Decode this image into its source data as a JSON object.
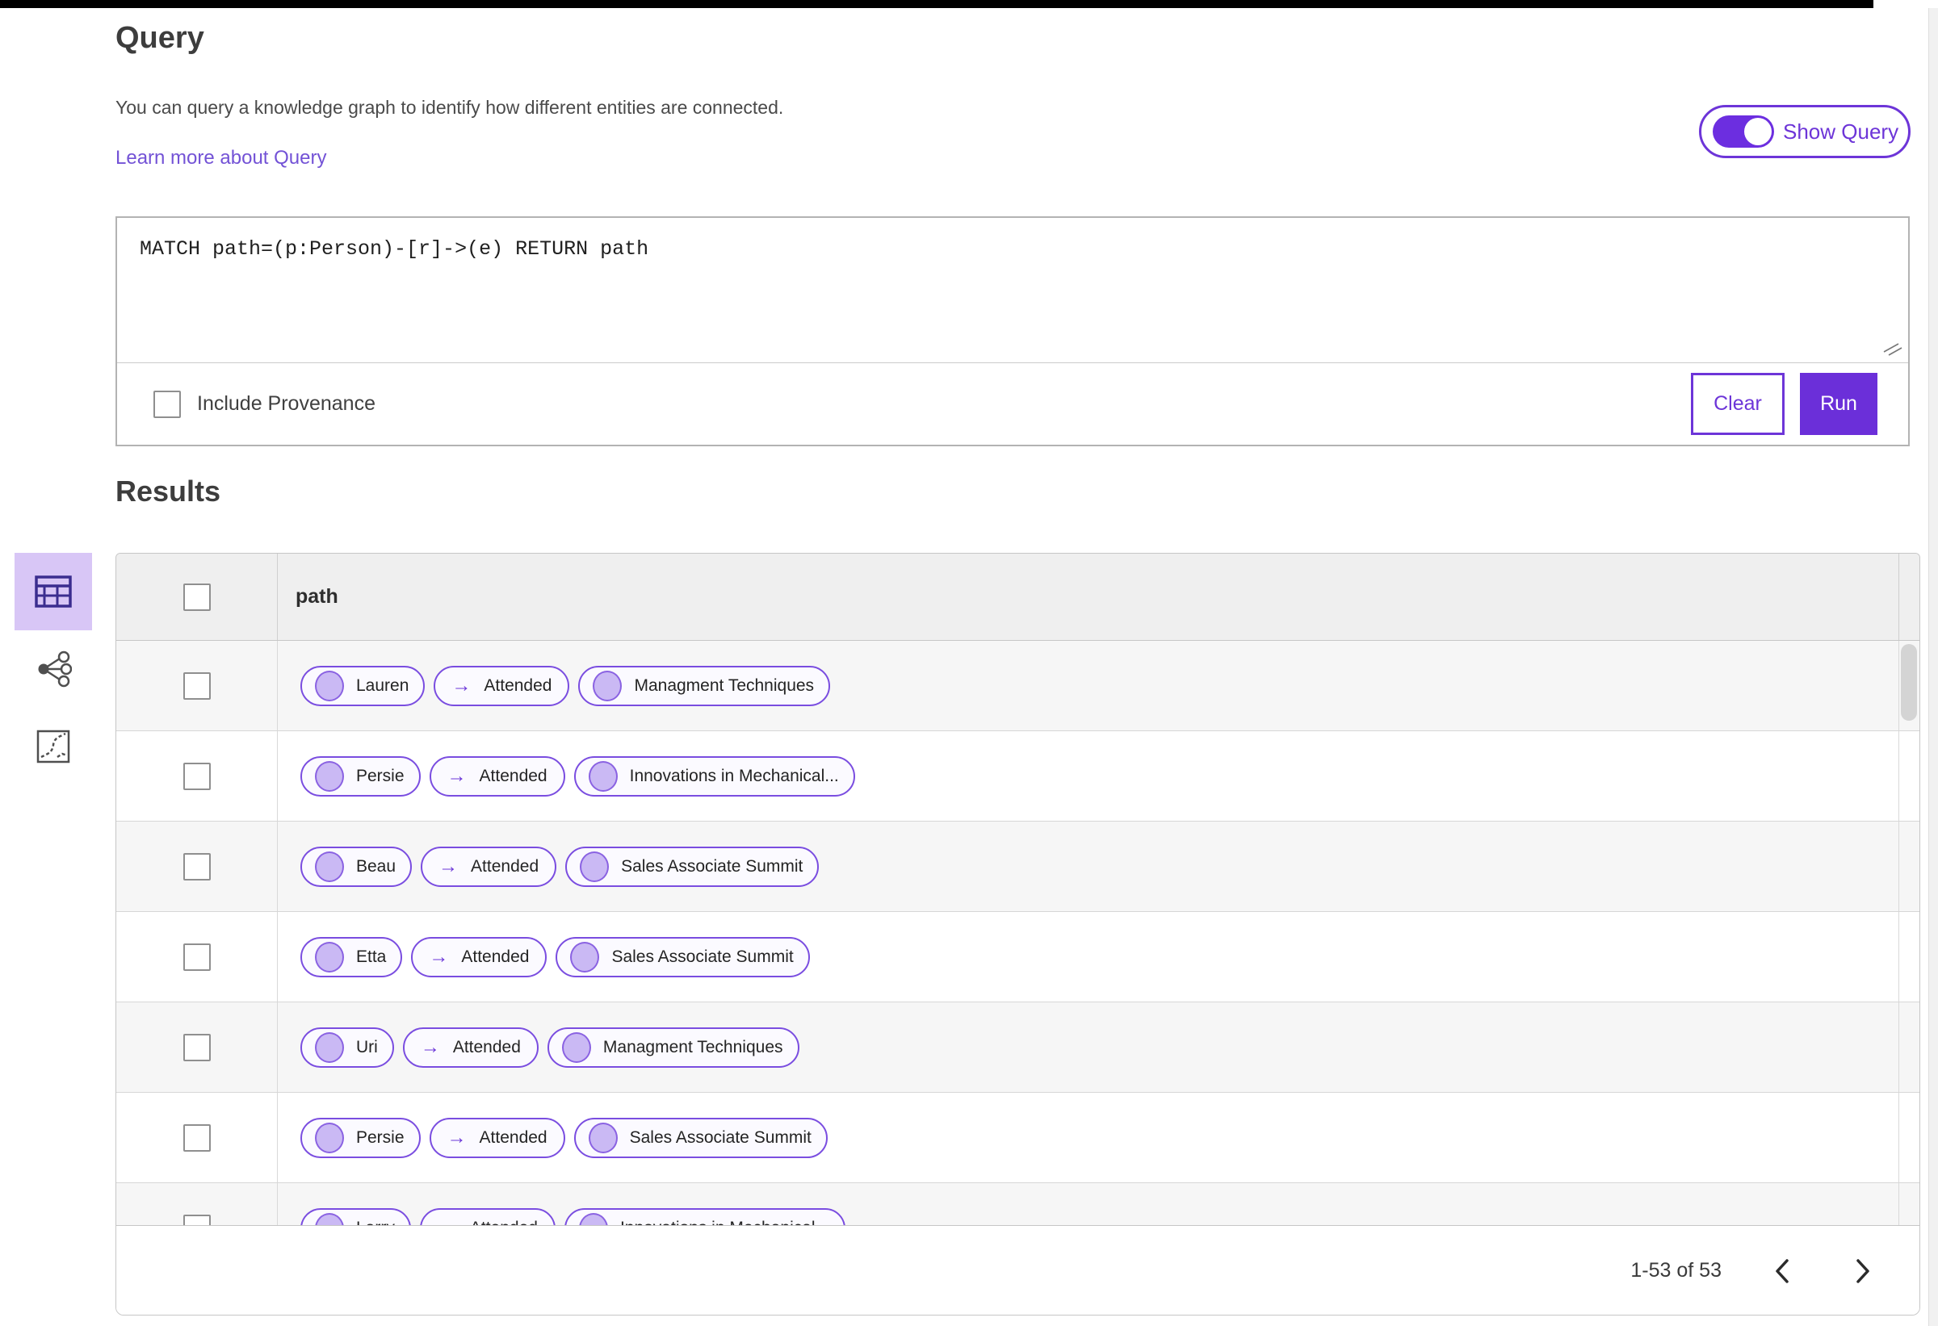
{
  "header": {
    "title": "Query",
    "description": "You can query a knowledge graph to identify how different entities are connected.",
    "learn_more": "Learn more about Query",
    "show_query": {
      "label": "Show Query",
      "state": "on"
    }
  },
  "query_panel": {
    "query_text": "MATCH path=(p:Person)-[r]->(e) RETURN path",
    "include_provenance": {
      "label": "Include Provenance",
      "checked": false
    },
    "clear_label": "Clear",
    "run_label": "Run"
  },
  "results": {
    "title": "Results",
    "column_header": "path",
    "views": [
      {
        "name": "table-view",
        "icon": "table-icon",
        "selected": true
      },
      {
        "name": "graph-view",
        "icon": "network-icon",
        "selected": false
      },
      {
        "name": "chart-view",
        "icon": "chart-icon",
        "selected": false
      }
    ],
    "arrow_glyph": "→",
    "rows": [
      {
        "source": "Lauren",
        "edge": "Attended",
        "target": "Managment Techniques"
      },
      {
        "source": "Persie",
        "edge": "Attended",
        "target": "Innovations in Mechanical..."
      },
      {
        "source": "Beau",
        "edge": "Attended",
        "target": "Sales Associate Summit"
      },
      {
        "source": "Etta",
        "edge": "Attended",
        "target": "Sales Associate Summit"
      },
      {
        "source": "Uri",
        "edge": "Attended",
        "target": "Managment Techniques"
      },
      {
        "source": "Persie",
        "edge": "Attended",
        "target": "Sales Associate Summit"
      },
      {
        "source": "Larry",
        "edge": "Attended",
        "target": "Innovations in Mechanical..."
      }
    ],
    "pagination": {
      "range_label": "1-53 of 53"
    }
  },
  "colors": {
    "accent": "#6b2fd9",
    "pill_border": "#7a4de0",
    "node_fill": "#cab9f4",
    "link": "#7352d6",
    "selected_view_bg": "#d8c6f6"
  }
}
